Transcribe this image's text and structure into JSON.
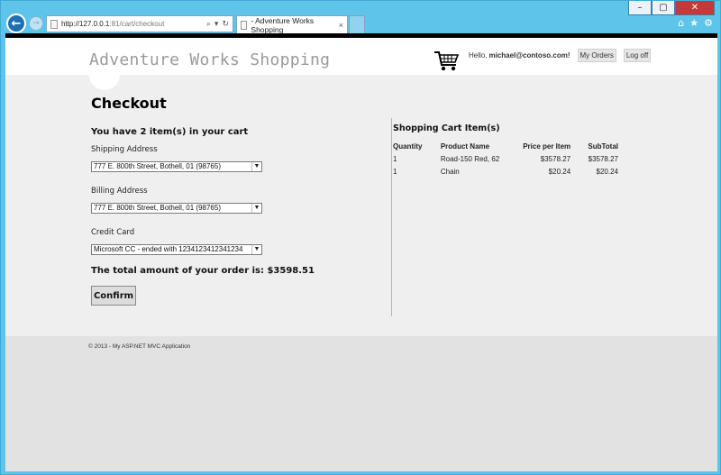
{
  "browser": {
    "url_host": "http://127.0.0.1",
    "url_path": ":81/cart/checkout",
    "tab_title": "- Adventure Works Shopping",
    "tab_close": "×",
    "back_glyph": "←",
    "fwd_glyph": "→",
    "tools": [
      "⌕",
      "▾",
      "↻"
    ],
    "win_minimize": "–",
    "win_maximize": "▢",
    "win_close": "✕",
    "icons": {
      "home": "⌂",
      "favorites": "★",
      "settings": "⚙"
    }
  },
  "header": {
    "site_title": "Adventure Works Shopping",
    "greeting": "Hello,",
    "user": "michael@contoso.com!",
    "my_orders": "My Orders",
    "log_off": "Log off"
  },
  "checkout": {
    "title": "Checkout",
    "cart_count": "You have 2 item(s) in your cart",
    "shipping_label": "Shipping Address",
    "shipping_value": "777 E. 800th Street, Bothell, 01 (98765)",
    "billing_label": "Billing Address",
    "billing_value": "777 E. 800th Street, Bothell, 01 (98765)",
    "card_label": "Credit Card",
    "card_value": "Microsoft CC - ended with 1234123412341234",
    "total": "The total amount of your order is: $3598.51",
    "confirm": "Confirm"
  },
  "cart": {
    "heading": "Shopping Cart Item(s)",
    "columns": [
      "Quantity",
      "Product Name",
      "Price per Item",
      "SubTotal"
    ],
    "rows": [
      {
        "qty": "1",
        "name": "Road-150 Red, 62",
        "price": "$3578.27",
        "subtotal": "$3578.27"
      },
      {
        "qty": "1",
        "name": "Chain",
        "price": "$20.24",
        "subtotal": "$20.24"
      }
    ]
  },
  "footer": {
    "text": "© 2013 - My ASP.NET MVC Application"
  }
}
